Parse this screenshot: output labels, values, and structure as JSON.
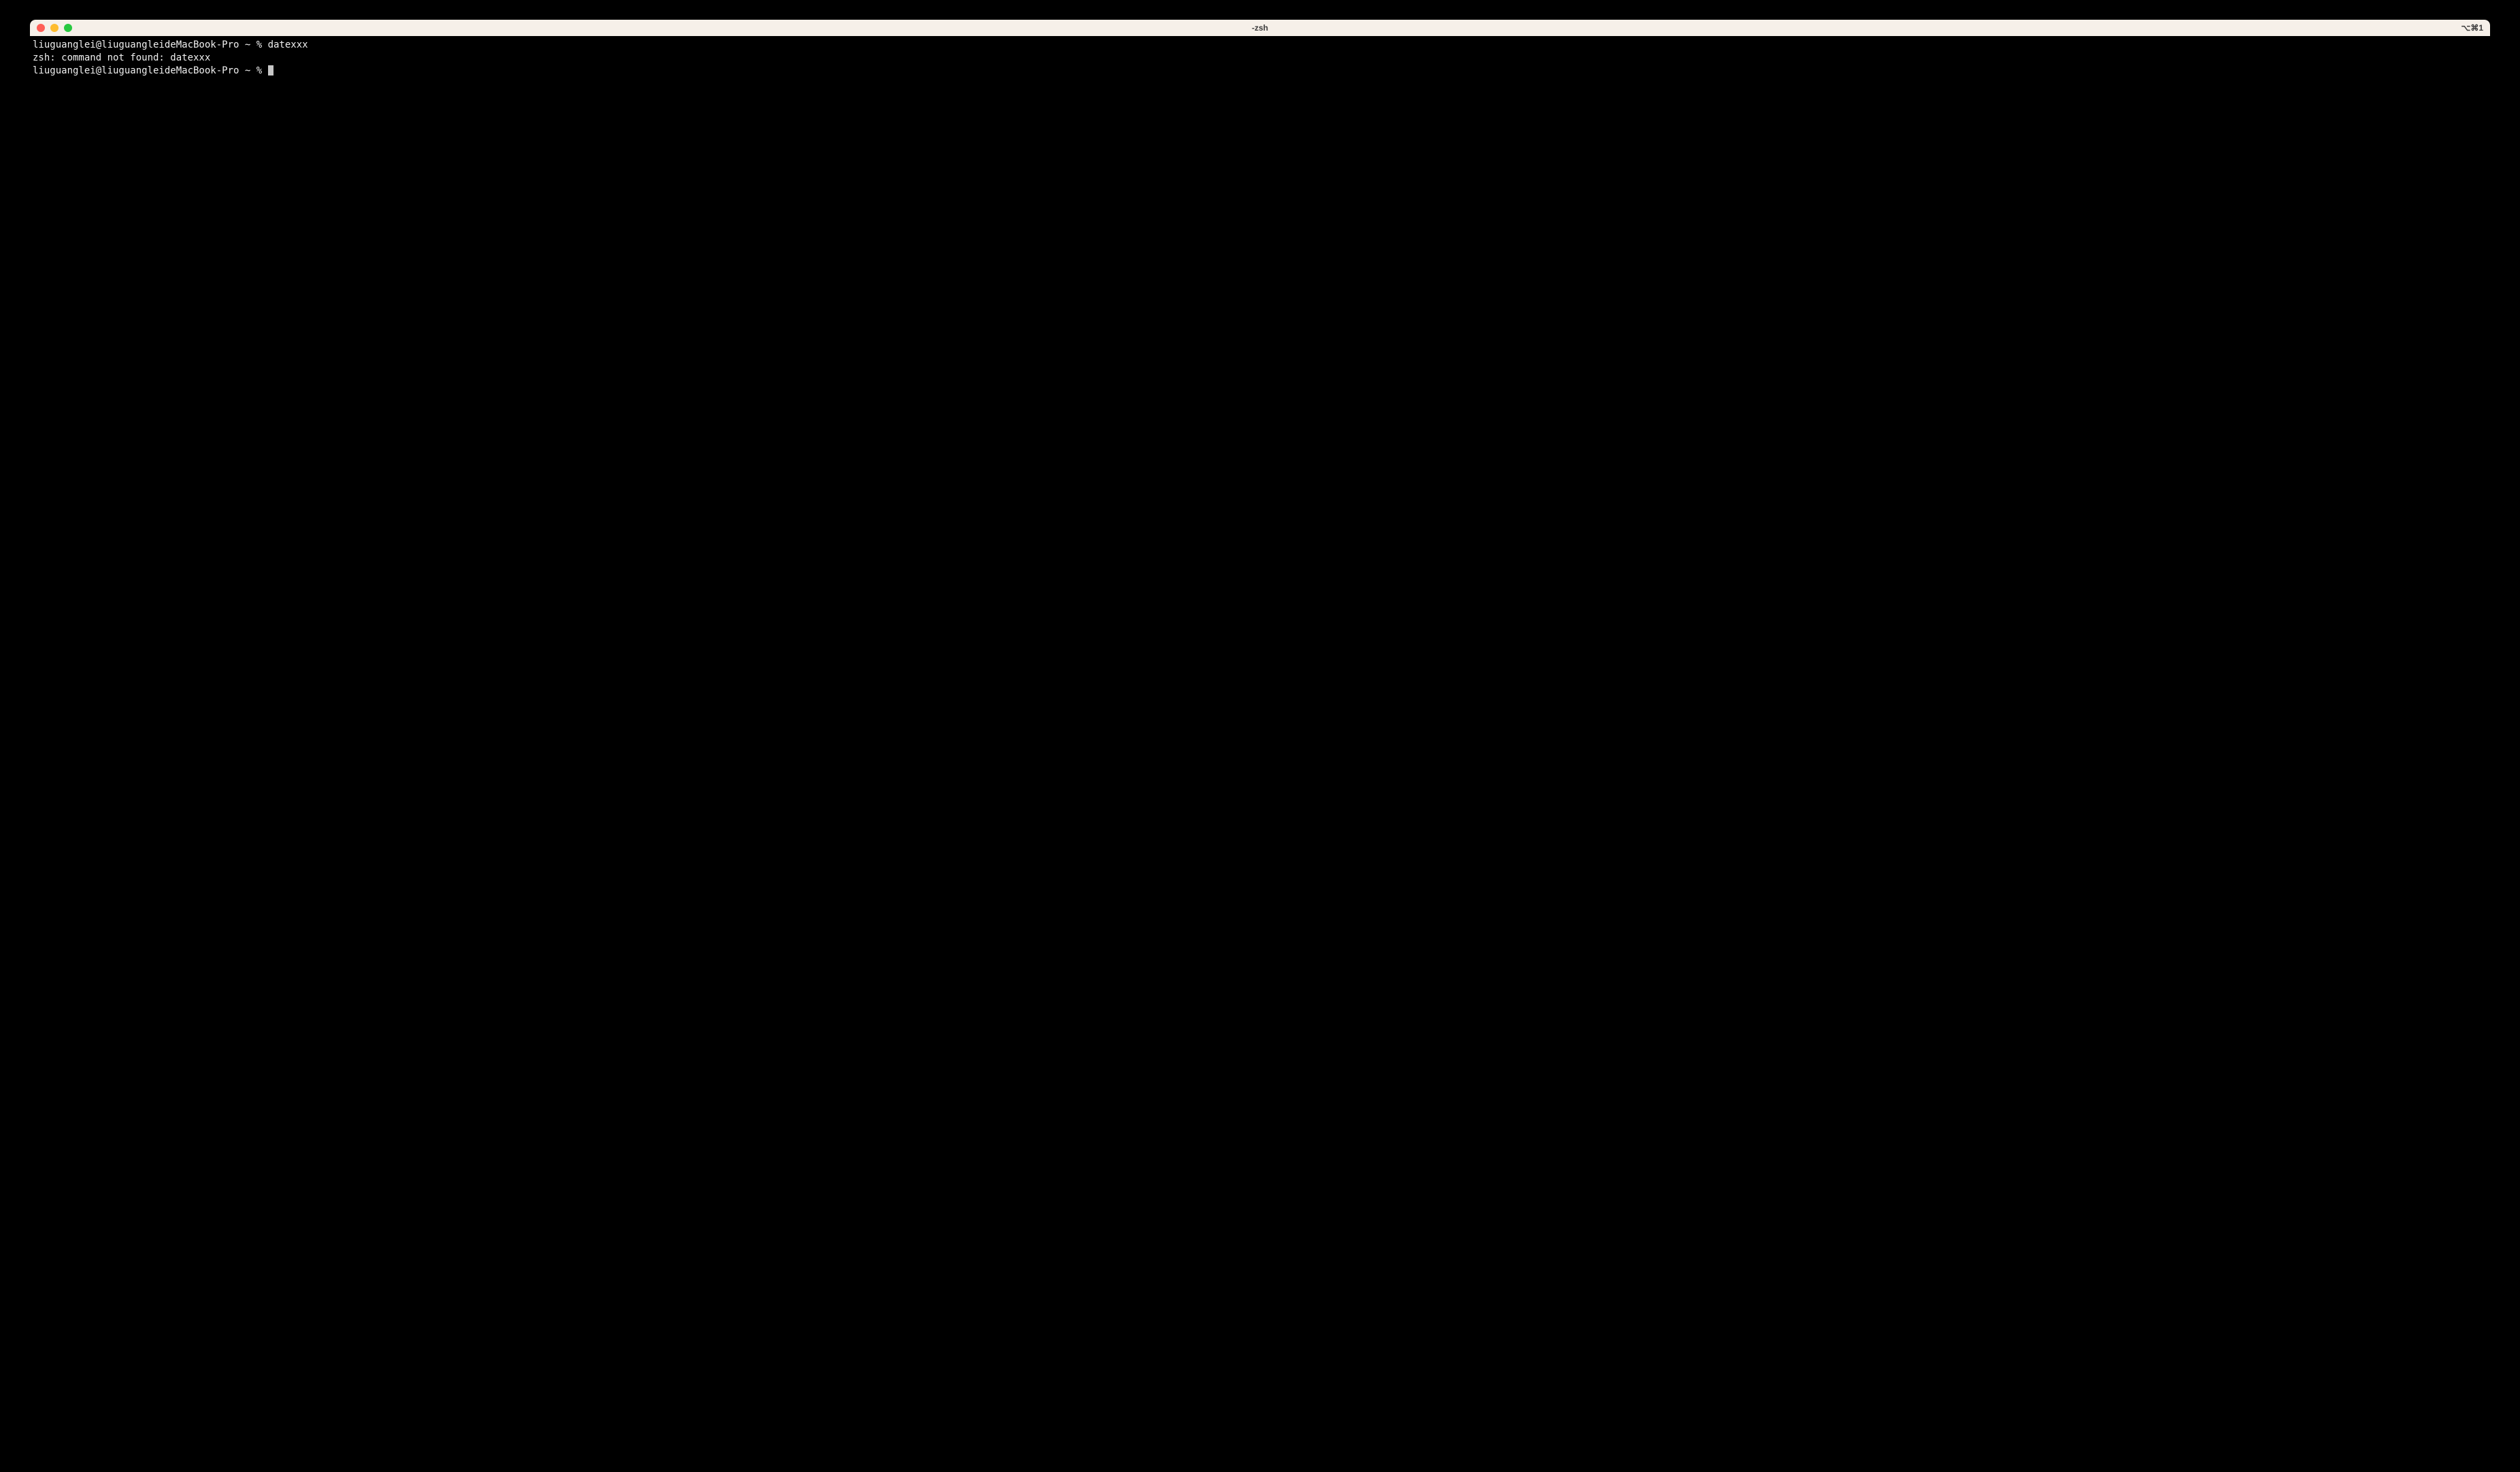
{
  "window": {
    "title": "-zsh",
    "shortcut": "⌥⌘1"
  },
  "terminal": {
    "lines": [
      "liuguanglei@liuguangleideMacBook-Pro ~ % datexxx",
      "zsh: command not found: datexxx"
    ],
    "prompt": "liuguanglei@liuguangleideMacBook-Pro ~ % "
  }
}
